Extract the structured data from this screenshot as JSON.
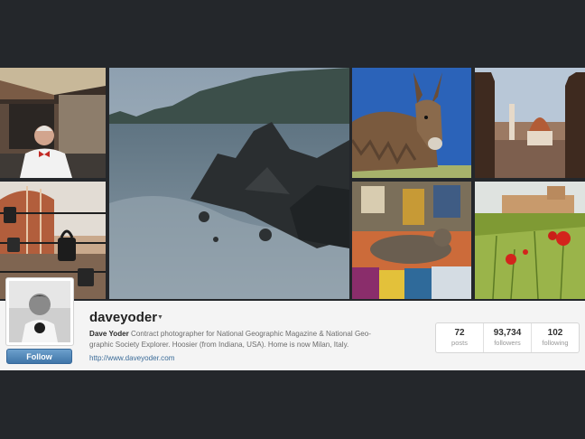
{
  "profile": {
    "username": "daveyoder",
    "full_name": "Dave Yoder",
    "bio": "Contract photographer for National Geographic Magazine & National Geographic Society Explorer. Hoosier (from Indiana, USA). Home is now Milan, Italy.",
    "bio_line1": "Contract photographer for National Geographic Magazine & National Geo-",
    "bio_line2": "graphic Society Explorer. Hoosier (from Indiana, USA). Home is now Milan, Italy.",
    "website": "http://www.daveyoder.com",
    "follow_label": "Follow",
    "caret_icon": "caret-down-icon"
  },
  "stats": [
    {
      "value": "72",
      "label": "posts"
    },
    {
      "value": "93,734",
      "label": "followers"
    },
    {
      "value": "102",
      "label": "following"
    }
  ]
}
